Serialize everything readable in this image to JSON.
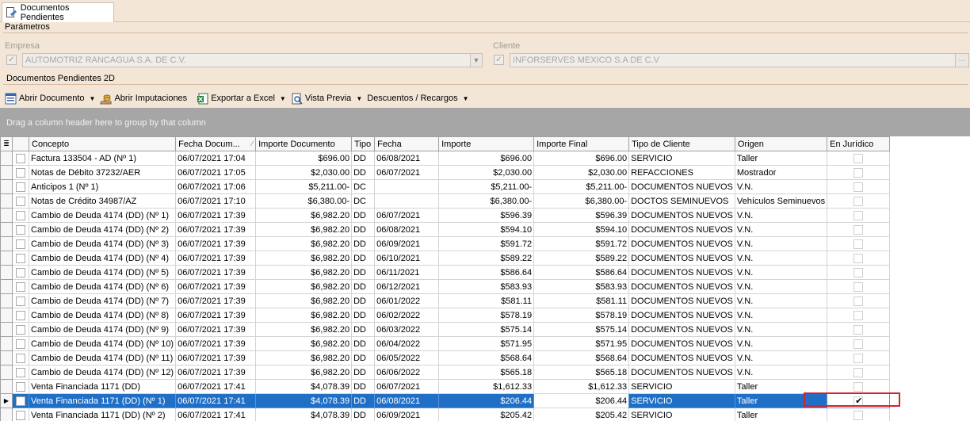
{
  "tab": {
    "label": "Documentos Pendientes",
    "icon": "document-edit-icon"
  },
  "parameters": {
    "title": "Parámetros",
    "empresa_caption": "Empresa",
    "empresa_value": "AUTOMOTRIZ RANCAGUA S.A. DE C.V.",
    "cliente_caption": "Cliente",
    "cliente_value": "INFORSERVES MEXICO S.A DE C.V",
    "ellipsis": "···"
  },
  "section": {
    "title": "Documentos Pendientes 2D"
  },
  "toolbar": {
    "abrir_documento": "Abrir Documento",
    "abrir_imputaciones": "Abrir Imputaciones",
    "exportar_excel": "Exportar a Excel",
    "vista_previa": "Vista Previa",
    "descuentos_recargos": "Descuentos / Recargos"
  },
  "group_panel": "Drag a column header here to group by that column",
  "columns": {
    "concepto": "Concepto",
    "fecha_doc": "Fecha Docum...",
    "importe_doc": "Importe Documento",
    "tipo": "Tipo",
    "fecha": "Fecha",
    "importe": "Importe",
    "importe_final": "Importe Final",
    "tipo_cliente": "Tipo de Cliente",
    "origen": "Origen",
    "en_juridico": "En Jurídico"
  },
  "rows": [
    {
      "concepto": "Factura 133504 - AD (Nº 1)",
      "fecha_doc": "06/07/2021 17:04",
      "importe_doc": "$696.00",
      "tipo": "DD",
      "fecha": "06/08/2021",
      "importe": "$696.00",
      "importe_final": "$696.00",
      "tipo_cliente": "SERVICIO",
      "origen": "Taller",
      "selected": false,
      "juridico": false
    },
    {
      "concepto": "Notas de Débito 37232/AER",
      "fecha_doc": "06/07/2021 17:05",
      "importe_doc": "$2,030.00",
      "tipo": "DD",
      "fecha": "06/07/2021",
      "importe": "$2,030.00",
      "importe_final": "$2,030.00",
      "tipo_cliente": "REFACCIONES",
      "origen": "Mostrador",
      "selected": false,
      "juridico": false
    },
    {
      "concepto": "Anticipos 1 (Nº 1)",
      "fecha_doc": "06/07/2021 17:06",
      "importe_doc": "$5,211.00-",
      "tipo": "DC",
      "fecha": "",
      "importe": "$5,211.00-",
      "importe_final": "$5,211.00-",
      "tipo_cliente": "DOCUMENTOS NUEVOS",
      "origen": "V.N.",
      "selected": false,
      "juridico": false
    },
    {
      "concepto": "Notas de Crédito 34987/AZ",
      "fecha_doc": "06/07/2021 17:10",
      "importe_doc": "$6,380.00-",
      "tipo": "DC",
      "fecha": "",
      "importe": "$6,380.00-",
      "importe_final": "$6,380.00-",
      "tipo_cliente": "DOCTOS SEMINUEVOS",
      "origen": "Vehículos Seminuevos",
      "selected": false,
      "juridico": false
    },
    {
      "concepto": "Cambio de Deuda 4174 (DD) (Nº 1)",
      "fecha_doc": "06/07/2021 17:39",
      "importe_doc": "$6,982.20",
      "tipo": "DD",
      "fecha": "06/07/2021",
      "importe": "$596.39",
      "importe_final": "$596.39",
      "tipo_cliente": "DOCUMENTOS NUEVOS",
      "origen": "V.N.",
      "selected": false,
      "juridico": false
    },
    {
      "concepto": "Cambio de Deuda 4174 (DD) (Nº 2)",
      "fecha_doc": "06/07/2021 17:39",
      "importe_doc": "$6,982.20",
      "tipo": "DD",
      "fecha": "06/08/2021",
      "importe": "$594.10",
      "importe_final": "$594.10",
      "tipo_cliente": "DOCUMENTOS NUEVOS",
      "origen": "V.N.",
      "selected": false,
      "juridico": false
    },
    {
      "concepto": "Cambio de Deuda 4174 (DD) (Nº 3)",
      "fecha_doc": "06/07/2021 17:39",
      "importe_doc": "$6,982.20",
      "tipo": "DD",
      "fecha": "06/09/2021",
      "importe": "$591.72",
      "importe_final": "$591.72",
      "tipo_cliente": "DOCUMENTOS NUEVOS",
      "origen": "V.N.",
      "selected": false,
      "juridico": false
    },
    {
      "concepto": "Cambio de Deuda 4174 (DD) (Nº 4)",
      "fecha_doc": "06/07/2021 17:39",
      "importe_doc": "$6,982.20",
      "tipo": "DD",
      "fecha": "06/10/2021",
      "importe": "$589.22",
      "importe_final": "$589.22",
      "tipo_cliente": "DOCUMENTOS NUEVOS",
      "origen": "V.N.",
      "selected": false,
      "juridico": false
    },
    {
      "concepto": "Cambio de Deuda 4174 (DD) (Nº 5)",
      "fecha_doc": "06/07/2021 17:39",
      "importe_doc": "$6,982.20",
      "tipo": "DD",
      "fecha": "06/11/2021",
      "importe": "$586.64",
      "importe_final": "$586.64",
      "tipo_cliente": "DOCUMENTOS NUEVOS",
      "origen": "V.N.",
      "selected": false,
      "juridico": false
    },
    {
      "concepto": "Cambio de Deuda 4174 (DD) (Nº 6)",
      "fecha_doc": "06/07/2021 17:39",
      "importe_doc": "$6,982.20",
      "tipo": "DD",
      "fecha": "06/12/2021",
      "importe": "$583.93",
      "importe_final": "$583.93",
      "tipo_cliente": "DOCUMENTOS NUEVOS",
      "origen": "V.N.",
      "selected": false,
      "juridico": false
    },
    {
      "concepto": "Cambio de Deuda 4174 (DD) (Nº 7)",
      "fecha_doc": "06/07/2021 17:39",
      "importe_doc": "$6,982.20",
      "tipo": "DD",
      "fecha": "06/01/2022",
      "importe": "$581.11",
      "importe_final": "$581.11",
      "tipo_cliente": "DOCUMENTOS NUEVOS",
      "origen": "V.N.",
      "selected": false,
      "juridico": false
    },
    {
      "concepto": "Cambio de Deuda 4174 (DD) (Nº 8)",
      "fecha_doc": "06/07/2021 17:39",
      "importe_doc": "$6,982.20",
      "tipo": "DD",
      "fecha": "06/02/2022",
      "importe": "$578.19",
      "importe_final": "$578.19",
      "tipo_cliente": "DOCUMENTOS NUEVOS",
      "origen": "V.N.",
      "selected": false,
      "juridico": false
    },
    {
      "concepto": "Cambio de Deuda 4174 (DD) (Nº 9)",
      "fecha_doc": "06/07/2021 17:39",
      "importe_doc": "$6,982.20",
      "tipo": "DD",
      "fecha": "06/03/2022",
      "importe": "$575.14",
      "importe_final": "$575.14",
      "tipo_cliente": "DOCUMENTOS NUEVOS",
      "origen": "V.N.",
      "selected": false,
      "juridico": false
    },
    {
      "concepto": "Cambio de Deuda 4174 (DD) (Nº 10)",
      "fecha_doc": "06/07/2021 17:39",
      "importe_doc": "$6,982.20",
      "tipo": "DD",
      "fecha": "06/04/2022",
      "importe": "$571.95",
      "importe_final": "$571.95",
      "tipo_cliente": "DOCUMENTOS NUEVOS",
      "origen": "V.N.",
      "selected": false,
      "juridico": false
    },
    {
      "concepto": "Cambio de Deuda 4174 (DD) (Nº 11)",
      "fecha_doc": "06/07/2021 17:39",
      "importe_doc": "$6,982.20",
      "tipo": "DD",
      "fecha": "06/05/2022",
      "importe": "$568.64",
      "importe_final": "$568.64",
      "tipo_cliente": "DOCUMENTOS NUEVOS",
      "origen": "V.N.",
      "selected": false,
      "juridico": false
    },
    {
      "concepto": "Cambio de Deuda 4174 (DD) (Nº 12)",
      "fecha_doc": "06/07/2021 17:39",
      "importe_doc": "$6,982.20",
      "tipo": "DD",
      "fecha": "06/06/2022",
      "importe": "$565.18",
      "importe_final": "$565.18",
      "tipo_cliente": "DOCUMENTOS NUEVOS",
      "origen": "V.N.",
      "selected": false,
      "juridico": false
    },
    {
      "concepto": "Venta Financiada 1171 (DD)",
      "fecha_doc": "06/07/2021 17:41",
      "importe_doc": "$4,078.39",
      "tipo": "DD",
      "fecha": "06/07/2021",
      "importe": "$1,612.33",
      "importe_final": "$1,612.33",
      "tipo_cliente": "SERVICIO",
      "origen": "Taller",
      "selected": false,
      "juridico": false
    },
    {
      "concepto": "Venta Financiada 1171 (DD) (Nº 1)",
      "fecha_doc": "06/07/2021 17:41",
      "importe_doc": "$4,078.39",
      "tipo": "DD",
      "fecha": "06/08/2021",
      "importe": "$206.44",
      "importe_final": "$206.44",
      "tipo_cliente": "SERVICIO",
      "origen": "Taller",
      "selected": true,
      "juridico": true
    },
    {
      "concepto": "Venta Financiada 1171 (DD) (Nº 2)",
      "fecha_doc": "06/07/2021 17:41",
      "importe_doc": "$4,078.39",
      "tipo": "DD",
      "fecha": "06/09/2021",
      "importe": "$205.42",
      "importe_final": "$205.42",
      "tipo_cliente": "SERVICIO",
      "origen": "Taller",
      "selected": false,
      "juridico": false
    }
  ],
  "colors": {
    "background": "#f4e6d6",
    "selection": "#1f6fc6",
    "group_panel": "#a6a6a6",
    "highlight_box": "#d8202a"
  }
}
